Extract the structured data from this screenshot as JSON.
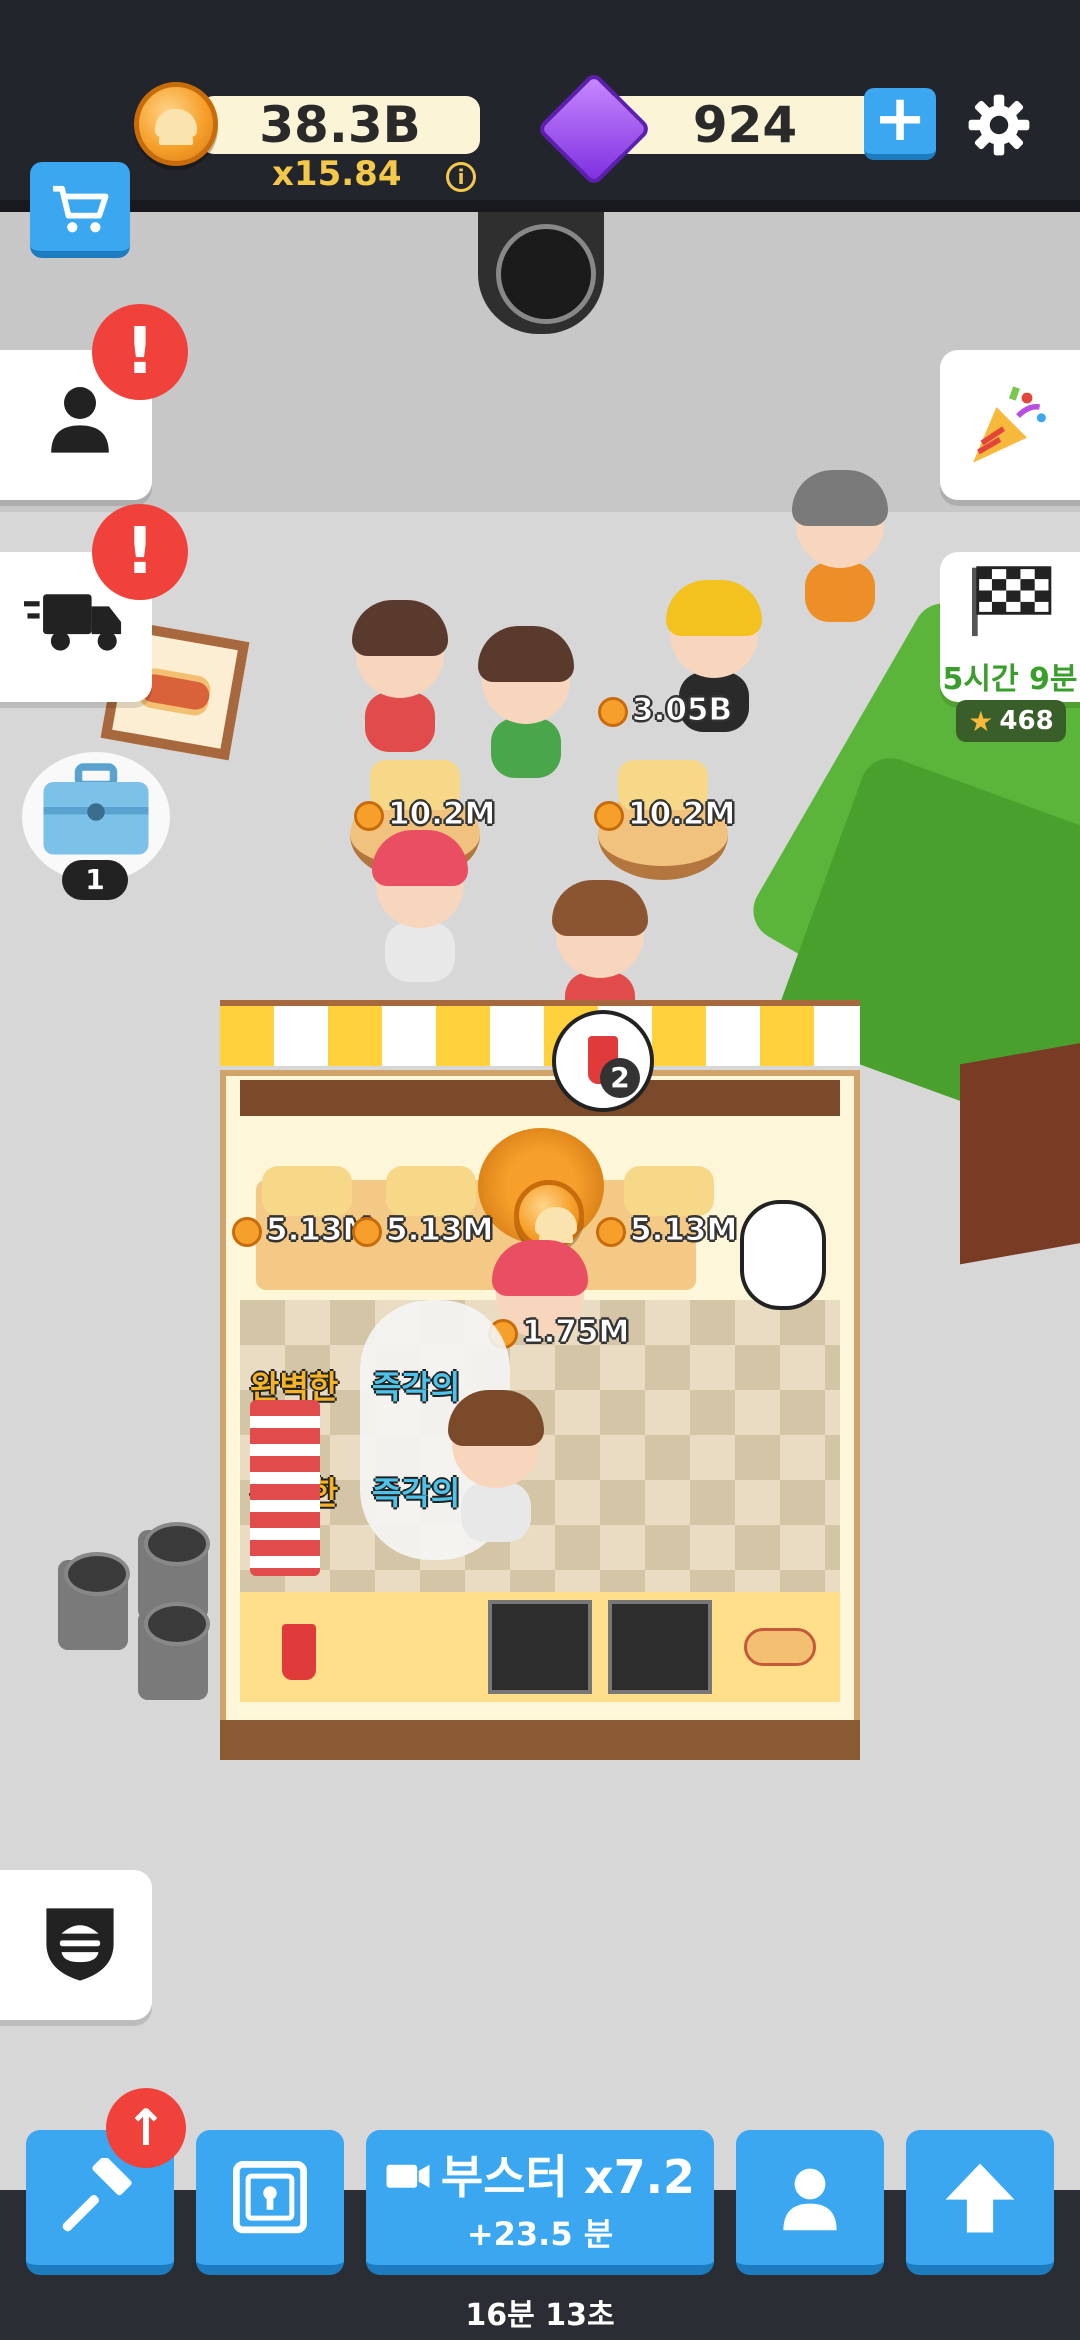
{
  "hud": {
    "coins": "38.3B",
    "multiplier": "x15.84",
    "info_glyph": "i",
    "gems": "924",
    "plus_glyph": "+"
  },
  "side": {
    "alert_glyph": "!",
    "suitcase_count": "1",
    "race_timer": "5시간 9분",
    "race_stars": "468"
  },
  "world": {
    "customer_coin": "3.05B",
    "table_left_amount": "10.2M",
    "table_right_amount": "10.2M",
    "counter_amounts": [
      "5.13M",
      "5.13M",
      "5.13M"
    ],
    "cashier_amount": "1.75M",
    "order_bubble_count": "2",
    "perfect_label": "완벽한",
    "instant_label": "즉각의"
  },
  "bottom": {
    "booster_label": "부스터 x7.2",
    "booster_sub": "+23.5 분",
    "timer": "16분 13초"
  },
  "colors": {
    "accent_blue": "#3aa7f0",
    "alert_red": "#f0413a",
    "coin_orange": "#f6a02b",
    "gem_purple": "#8a3ff0",
    "race_green": "#3a9e2c"
  },
  "icons": [
    "cart-icon",
    "person-icon",
    "truck-icon",
    "suitcase-icon",
    "party-popper-icon",
    "checkered-flag-icon",
    "star-icon",
    "burger-shield-icon",
    "hammer-icon",
    "safe-icon",
    "video-icon",
    "profile-icon",
    "arrow-up-icon",
    "gear-icon",
    "gem-icon",
    "coin-icon"
  ]
}
